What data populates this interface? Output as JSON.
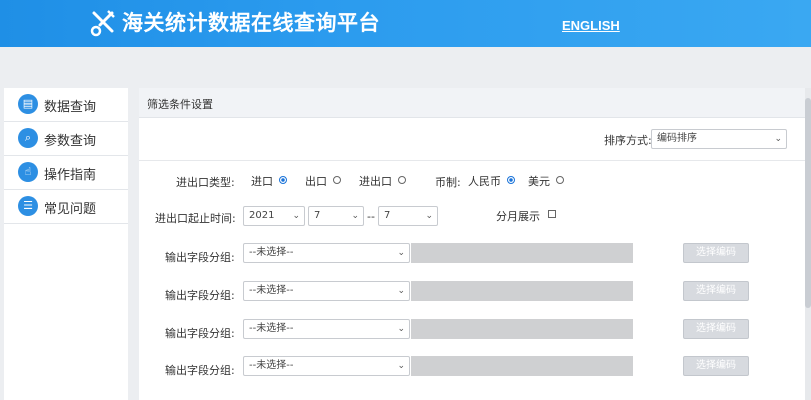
{
  "header": {
    "title": "海关统计数据在线查询平台",
    "lang_link": "ENGLISH",
    "logo_icon": "tools-icon"
  },
  "sidebar": {
    "items": [
      {
        "label": "数据查询",
        "icon": "chart-icon"
      },
      {
        "label": "参数查询",
        "icon": "search-icon"
      },
      {
        "label": "操作指南",
        "icon": "hand-icon"
      },
      {
        "label": "常见问题",
        "icon": "list-icon"
      }
    ]
  },
  "panel": {
    "title": "筛选条件设置",
    "sort": {
      "label": "排序方式:",
      "value": "编码排序"
    },
    "trade_type": {
      "label": "进出口类型:",
      "options": [
        "进口",
        "出口",
        "进出口"
      ],
      "selected": "进口"
    },
    "currency": {
      "label": "币制:",
      "options": [
        "人民币",
        "美元"
      ],
      "selected": "人民币"
    },
    "period": {
      "label": "进出口起止时间:",
      "year": "2021",
      "from_month": "7",
      "separator": "--",
      "to_month": "7"
    },
    "monthly": {
      "label": "分月展示"
    },
    "field_groups": [
      {
        "label": "输出字段分组:",
        "value": "--未选择--",
        "button": "选择编码"
      },
      {
        "label": "输出字段分组:",
        "value": "--未选择--",
        "button": "选择编码"
      },
      {
        "label": "输出字段分组:",
        "value": "--未选择--",
        "button": "选择编码"
      },
      {
        "label": "输出字段分组:",
        "value": "--未选择--",
        "button": "选择编码"
      }
    ]
  },
  "colors": {
    "header": "#2b9bee",
    "accent": "#1a73d9",
    "nav_icon": "#2d8fe3"
  }
}
